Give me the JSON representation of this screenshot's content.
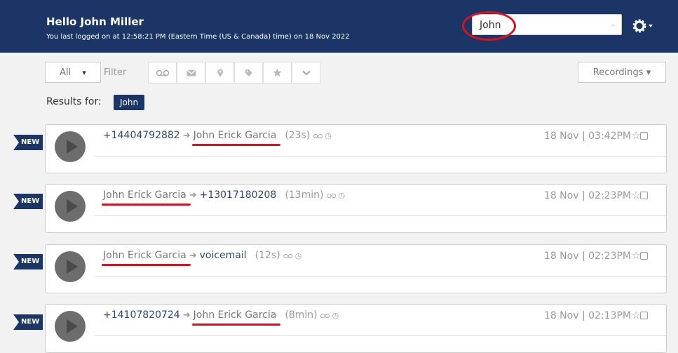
{
  "header": {
    "greeting": "Hello John Miller",
    "last_login": "You last logged on at 12:58:21 PM (Eastern Time (US & Canada) time) on 18 Nov 2022",
    "search_value": "John",
    "search_caret": "⌄",
    "settings_icon": "gear-icon"
  },
  "toolbar": {
    "all_label": "All",
    "all_caret": "▾",
    "filter_label": "Filter",
    "filters": [
      "voicemail-icon",
      "envelope-icon",
      "map-pin-icon",
      "tag-icon",
      "star-icon",
      "chevron-down-icon"
    ],
    "recordings_label": "Recordings ▾"
  },
  "results": {
    "label": "Results for:",
    "term": "John"
  },
  "calls": [
    {
      "badge": "NEW",
      "from": "+14404792882",
      "to": "John Erick Garcia",
      "duration": "(23s)",
      "date": "18 Nov | 03:42PM"
    },
    {
      "badge": "NEW",
      "from": "John Erick Garcia",
      "to": "+13017180208",
      "duration": "(13min)",
      "date": "18 Nov | 02:23PM"
    },
    {
      "badge": "NEW",
      "from": "John Erick Garcia",
      "to": "voicemail",
      "duration": "(12s)",
      "date": "18 Nov | 02:23PM"
    },
    {
      "badge": "NEW",
      "from": "+14107820724",
      "to": "John Erick Garcia",
      "duration": "(8min)",
      "date": "18 Nov | 02:13PM"
    }
  ],
  "icons": {
    "arrow": "➜",
    "voicemail": "ᴑᴑ",
    "clock": "◷",
    "star": "☆"
  },
  "colors": {
    "header_bg": "#1a3566",
    "highlight": "#d9121f",
    "number_text": "#2c4a73"
  }
}
